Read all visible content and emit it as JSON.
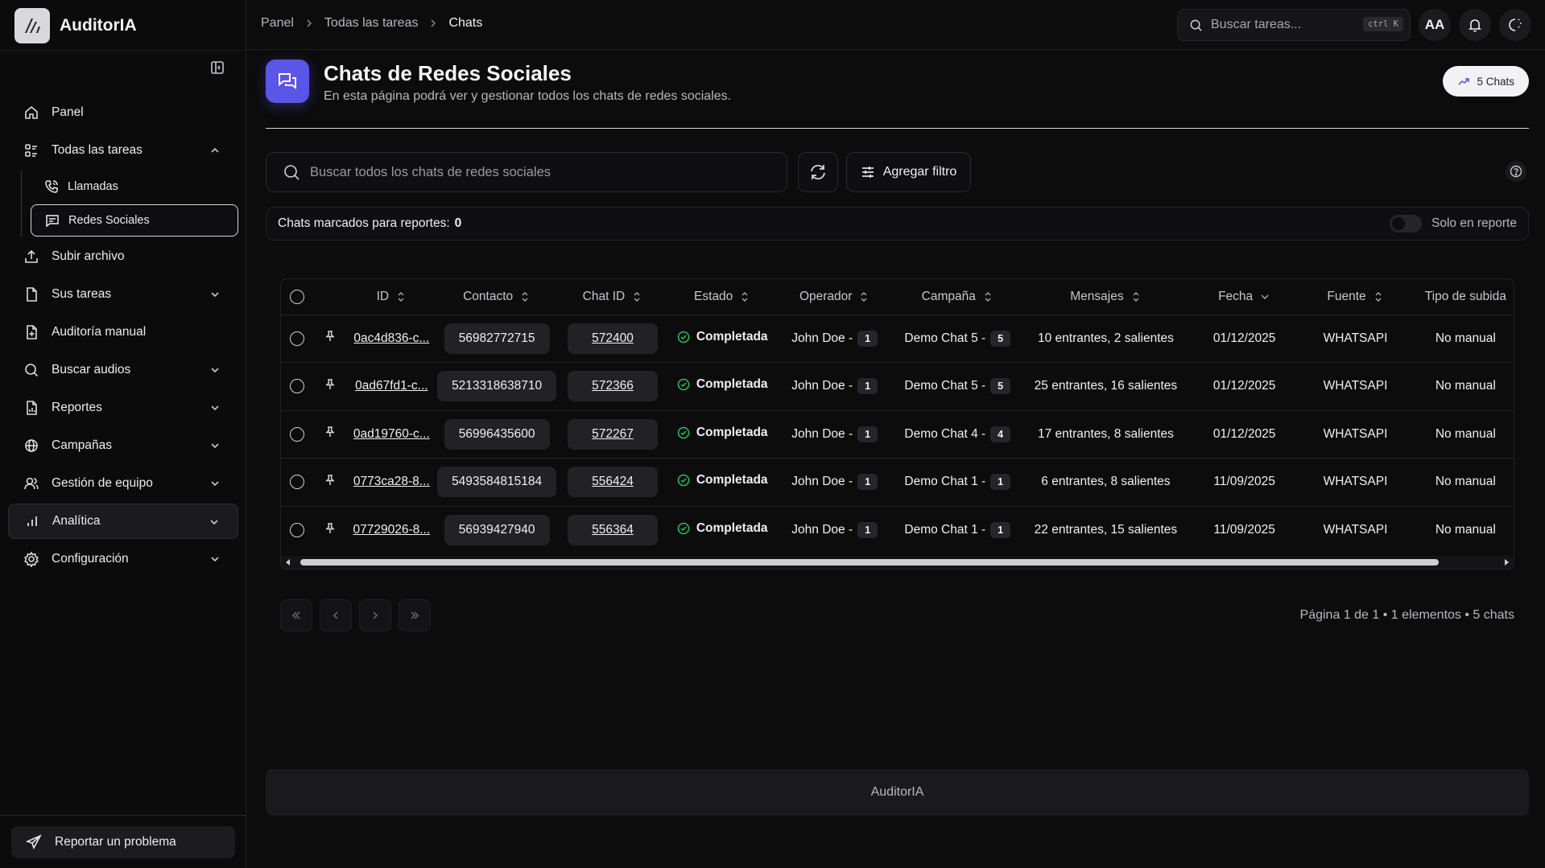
{
  "app": {
    "name": "AuditorIA"
  },
  "sidebar": {
    "items": [
      {
        "label": "Panel",
        "icon": "home-icon"
      },
      {
        "label": "Todas las tareas",
        "icon": "tasks-icon",
        "expanded": true,
        "children": [
          {
            "label": "Llamadas",
            "icon": "phone-icon"
          },
          {
            "label": "Redes Sociales",
            "icon": "chat-icon",
            "selected": true
          }
        ]
      },
      {
        "label": "Subir archivo",
        "icon": "upload-icon"
      },
      {
        "label": "Sus tareas",
        "icon": "file-icon"
      },
      {
        "label": "Auditoría manual",
        "icon": "file-plus-icon"
      },
      {
        "label": "Buscar audios",
        "icon": "search-icon"
      },
      {
        "label": "Reportes",
        "icon": "report-icon"
      },
      {
        "label": "Campañas",
        "icon": "globe-icon"
      },
      {
        "label": "Gestión de equipo",
        "icon": "team-icon"
      },
      {
        "label": "Analítica",
        "icon": "chart-icon"
      },
      {
        "label": "Configuración",
        "icon": "gear-icon"
      }
    ],
    "report_button": "Reportar un problema"
  },
  "topbar": {
    "breadcrumb": [
      "Panel",
      "Todas las tareas",
      "Chats"
    ],
    "search_placeholder": "Buscar tareas...",
    "shortcut": "ctrl K",
    "avatar": "AA"
  },
  "page": {
    "title": "Chats de Redes Sociales",
    "subtitle": "En esta página podrá ver y gestionar todos los chats de redes sociales.",
    "count_pill": "5 Chats",
    "search_placeholder": "Buscar todos los chats de redes sociales",
    "filter_button": "Agregar filtro",
    "marked_label": "Chats marcados para reportes:",
    "marked_count": "0",
    "toggle_label": "Solo en reporte"
  },
  "table": {
    "headers": [
      "ID",
      "Contacto",
      "Chat ID",
      "Estado",
      "Operador",
      "Campaña",
      "Mensajes",
      "Fecha",
      "Fuente",
      "Tipo de subida"
    ],
    "rows": [
      {
        "id": "0ac4d836-c...",
        "contacto": "56982772715",
        "chat_id": "572400",
        "estado": "Completada",
        "operador": "John Doe -",
        "operador_badge": "1",
        "campana": "Demo Chat 5 -",
        "campana_badge": "5",
        "mensajes": "10 entrantes, 2 salientes",
        "fecha": "01/12/2025",
        "fuente": "WHATSAPI",
        "tipo": "No manual"
      },
      {
        "id": "0ad67fd1-c...",
        "contacto": "5213318638710",
        "chat_id": "572366",
        "estado": "Completada",
        "operador": "John Doe -",
        "operador_badge": "1",
        "campana": "Demo Chat 5 -",
        "campana_badge": "5",
        "mensajes": "25 entrantes, 16 salientes",
        "fecha": "01/12/2025",
        "fuente": "WHATSAPI",
        "tipo": "No manual"
      },
      {
        "id": "0ad19760-c...",
        "contacto": "56996435600",
        "chat_id": "572267",
        "estado": "Completada",
        "operador": "John Doe -",
        "operador_badge": "1",
        "campana": "Demo Chat 4 -",
        "campana_badge": "4",
        "mensajes": "17 entrantes, 8 salientes",
        "fecha": "01/12/2025",
        "fuente": "WHATSAPI",
        "tipo": "No manual"
      },
      {
        "id": "0773ca28-8...",
        "contacto": "5493584815184",
        "chat_id": "556424",
        "estado": "Completada",
        "operador": "John Doe -",
        "operador_badge": "1",
        "campana": "Demo Chat 1 -",
        "campana_badge": "1",
        "mensajes": "6 entrantes, 8 salientes",
        "fecha": "11/09/2025",
        "fuente": "WHATSAPI",
        "tipo": "No manual"
      },
      {
        "id": "07729026-8...",
        "contacto": "56939427940",
        "chat_id": "556364",
        "estado": "Completada",
        "operador": "John Doe -",
        "operador_badge": "1",
        "campana": "Demo Chat 1 -",
        "campana_badge": "1",
        "mensajes": "22 entrantes, 15 salientes",
        "fecha": "11/09/2025",
        "fuente": "WHATSAPI",
        "tipo": "No manual"
      }
    ]
  },
  "pagination": {
    "info": "Página 1 de 1 • 1 elementos • 5 chats"
  },
  "footer": {
    "text": "AuditorIA"
  },
  "colors": {
    "accent": "#5b55e8",
    "success": "#22c55e",
    "background": "#0c0c0d"
  }
}
